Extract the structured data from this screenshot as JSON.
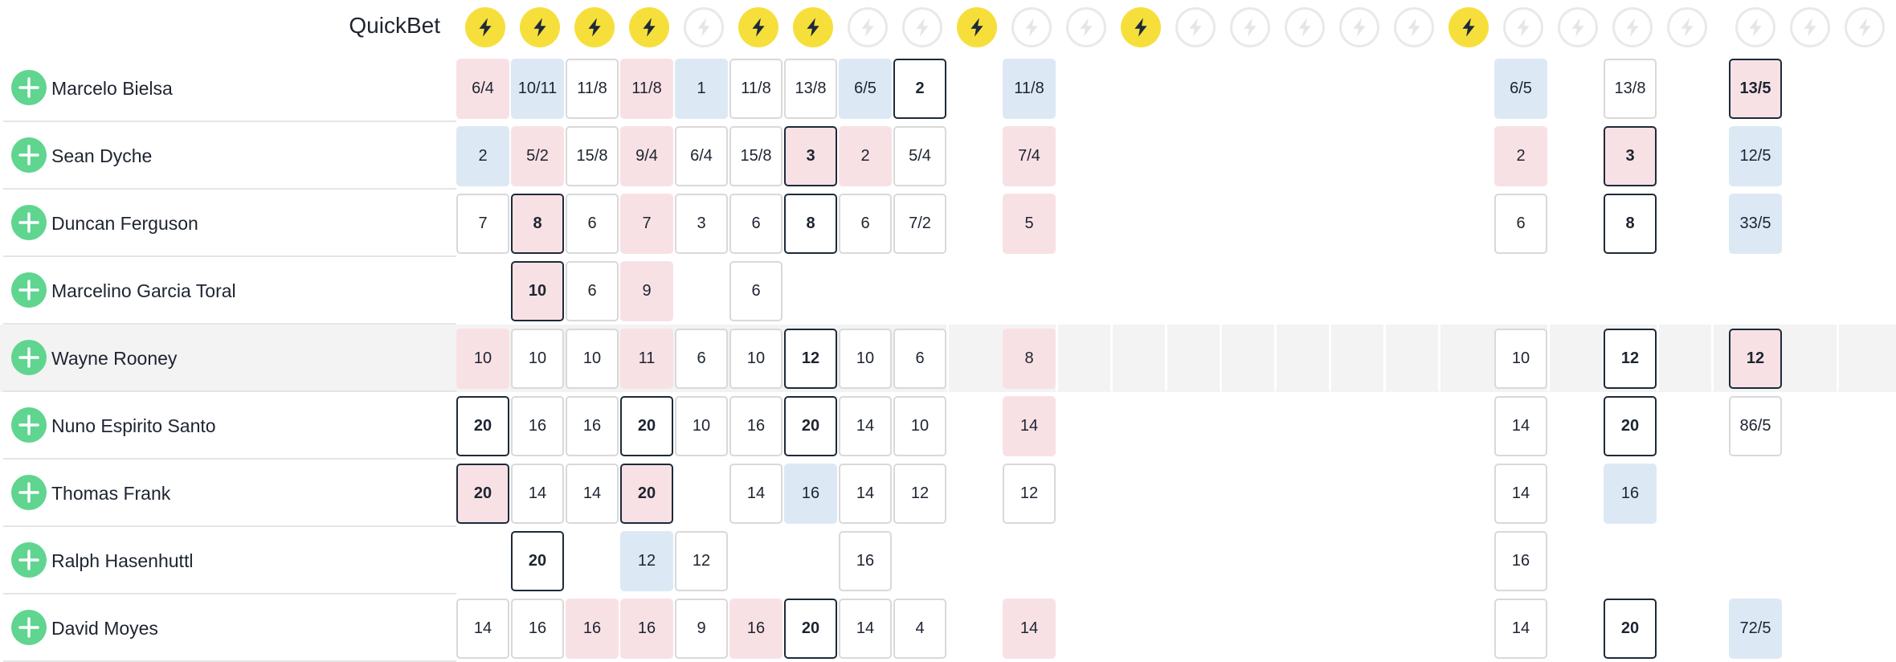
{
  "header": {
    "quickbet_label": "QuickBet",
    "bookmakers": [
      {
        "icon": "lightning-icon",
        "active": true
      },
      {
        "icon": "lightning-icon",
        "active": true
      },
      {
        "icon": "lightning-icon",
        "active": true
      },
      {
        "icon": "lightning-icon",
        "active": true
      },
      {
        "icon": "lightning-icon",
        "active": false
      },
      {
        "icon": "lightning-icon",
        "active": true
      },
      {
        "icon": "lightning-icon",
        "active": true
      },
      {
        "icon": "lightning-icon",
        "active": false
      },
      {
        "icon": "lightning-icon",
        "active": false
      },
      {
        "icon": "lightning-icon",
        "active": true
      },
      {
        "icon": "lightning-icon",
        "active": false
      },
      {
        "icon": "lightning-icon",
        "active": false
      },
      {
        "icon": "lightning-icon",
        "active": true
      },
      {
        "icon": "lightning-icon",
        "active": false
      },
      {
        "icon": "lightning-icon",
        "active": false
      },
      {
        "icon": "lightning-icon",
        "active": false
      },
      {
        "icon": "lightning-icon",
        "active": false
      },
      {
        "icon": "lightning-icon",
        "active": false
      },
      {
        "icon": "lightning-icon",
        "active": true
      },
      {
        "icon": "lightning-icon",
        "active": false
      },
      {
        "icon": "lightning-icon",
        "active": false
      },
      {
        "icon": "lightning-icon",
        "active": false
      },
      {
        "icon": "lightning-icon",
        "active": false
      },
      {
        "icon": "lightning-icon",
        "active": false
      },
      {
        "icon": "lightning-icon",
        "active": false
      },
      {
        "icon": "lightning-icon",
        "active": false
      }
    ]
  },
  "colors": {
    "quickbet_active": "#f7df3b",
    "add_button": "#5fd590",
    "odds_drifting": "#f8e1e5",
    "odds_shortening": "#dce9f5",
    "best_odds_border": "#1d2a39",
    "row_highlight": "#f3f3f3"
  },
  "rows": [
    {
      "name": "Marcelo Bielsa",
      "odds": [
        {
          "v": "6/4",
          "s": "p"
        },
        {
          "v": "10/11",
          "s": "b"
        },
        {
          "v": "11/8",
          "s": "w"
        },
        {
          "v": "11/8",
          "s": "p"
        },
        {
          "v": "1",
          "s": "b"
        },
        {
          "v": "11/8",
          "s": "w"
        },
        {
          "v": "13/8",
          "s": "w"
        },
        {
          "v": "6/5",
          "s": "b"
        },
        {
          "v": "2",
          "s": "w",
          "best": true
        },
        null,
        {
          "v": "11/8",
          "s": "b"
        },
        null,
        null,
        null,
        null,
        null,
        null,
        null,
        null,
        {
          "v": "6/5",
          "s": "b"
        },
        null,
        {
          "v": "13/8",
          "s": "w"
        },
        null,
        null,
        {
          "v": "13/5",
          "s": "p",
          "best": true
        },
        null
      ]
    },
    {
      "name": "Sean Dyche",
      "odds": [
        {
          "v": "2",
          "s": "b"
        },
        {
          "v": "5/2",
          "s": "p"
        },
        {
          "v": "15/8",
          "s": "w"
        },
        {
          "v": "9/4",
          "s": "p"
        },
        {
          "v": "6/4",
          "s": "w"
        },
        {
          "v": "15/8",
          "s": "w"
        },
        {
          "v": "3",
          "s": "p",
          "best": true
        },
        {
          "v": "2",
          "s": "p"
        },
        {
          "v": "5/4",
          "s": "w"
        },
        null,
        {
          "v": "7/4",
          "s": "p"
        },
        null,
        null,
        null,
        null,
        null,
        null,
        null,
        null,
        {
          "v": "2",
          "s": "p"
        },
        null,
        {
          "v": "3",
          "s": "p",
          "best": true
        },
        null,
        null,
        {
          "v": "12/5",
          "s": "b"
        },
        null
      ]
    },
    {
      "name": "Duncan Ferguson",
      "odds": [
        {
          "v": "7",
          "s": "w"
        },
        {
          "v": "8",
          "s": "p",
          "best": true
        },
        {
          "v": "6",
          "s": "w"
        },
        {
          "v": "7",
          "s": "p"
        },
        {
          "v": "3",
          "s": "w"
        },
        {
          "v": "6",
          "s": "w"
        },
        {
          "v": "8",
          "s": "w",
          "best": true
        },
        {
          "v": "6",
          "s": "w"
        },
        {
          "v": "7/2",
          "s": "w"
        },
        null,
        {
          "v": "5",
          "s": "p"
        },
        null,
        null,
        null,
        null,
        null,
        null,
        null,
        null,
        {
          "v": "6",
          "s": "w"
        },
        null,
        {
          "v": "8",
          "s": "w",
          "best": true
        },
        null,
        null,
        {
          "v": "33/5",
          "s": "b"
        },
        null
      ]
    },
    {
      "name": "Marcelino Garcia Toral",
      "odds": [
        null,
        {
          "v": "10",
          "s": "p",
          "best": true
        },
        {
          "v": "6",
          "s": "w"
        },
        {
          "v": "9",
          "s": "p"
        },
        null,
        {
          "v": "6",
          "s": "w"
        },
        null,
        null,
        null,
        null,
        null,
        null,
        null,
        null,
        null,
        null,
        null,
        null,
        null,
        null,
        null,
        null,
        null,
        null,
        null,
        null
      ]
    },
    {
      "name": "Wayne Rooney",
      "highlight": true,
      "odds": [
        {
          "v": "10",
          "s": "p"
        },
        {
          "v": "10",
          "s": "w"
        },
        {
          "v": "10",
          "s": "w"
        },
        {
          "v": "11",
          "s": "p"
        },
        {
          "v": "6",
          "s": "w"
        },
        {
          "v": "10",
          "s": "w"
        },
        {
          "v": "12",
          "s": "w",
          "best": true
        },
        {
          "v": "10",
          "s": "w"
        },
        {
          "v": "6",
          "s": "w"
        },
        null,
        {
          "v": "8",
          "s": "p"
        },
        null,
        null,
        null,
        null,
        null,
        null,
        null,
        null,
        {
          "v": "10",
          "s": "w"
        },
        null,
        {
          "v": "12",
          "s": "w",
          "best": true
        },
        null,
        null,
        {
          "v": "12",
          "s": "p",
          "best": true
        },
        null
      ]
    },
    {
      "name": "Nuno Espirito Santo",
      "odds": [
        {
          "v": "20",
          "s": "w",
          "best": true
        },
        {
          "v": "16",
          "s": "w"
        },
        {
          "v": "16",
          "s": "w"
        },
        {
          "v": "20",
          "s": "w",
          "best": true
        },
        {
          "v": "10",
          "s": "w"
        },
        {
          "v": "16",
          "s": "w"
        },
        {
          "v": "20",
          "s": "w",
          "best": true
        },
        {
          "v": "14",
          "s": "w"
        },
        {
          "v": "10",
          "s": "w"
        },
        null,
        {
          "v": "14",
          "s": "p"
        },
        null,
        null,
        null,
        null,
        null,
        null,
        null,
        null,
        {
          "v": "14",
          "s": "w"
        },
        null,
        {
          "v": "20",
          "s": "w",
          "best": true
        },
        null,
        null,
        {
          "v": "86/5",
          "s": "w"
        },
        null
      ]
    },
    {
      "name": "Thomas Frank",
      "odds": [
        {
          "v": "20",
          "s": "p",
          "best": true
        },
        {
          "v": "14",
          "s": "w"
        },
        {
          "v": "14",
          "s": "w"
        },
        {
          "v": "20",
          "s": "p",
          "best": true
        },
        null,
        {
          "v": "14",
          "s": "w"
        },
        {
          "v": "16",
          "s": "b"
        },
        {
          "v": "14",
          "s": "w"
        },
        {
          "v": "12",
          "s": "w"
        },
        null,
        {
          "v": "12",
          "s": "w"
        },
        null,
        null,
        null,
        null,
        null,
        null,
        null,
        null,
        {
          "v": "14",
          "s": "w"
        },
        null,
        {
          "v": "16",
          "s": "b"
        },
        null,
        null,
        null,
        null
      ]
    },
    {
      "name": "Ralph Hasenhuttl",
      "odds": [
        null,
        {
          "v": "20",
          "s": "w",
          "best": true
        },
        null,
        {
          "v": "12",
          "s": "b"
        },
        {
          "v": "12",
          "s": "w"
        },
        null,
        null,
        {
          "v": "16",
          "s": "w"
        },
        null,
        null,
        null,
        null,
        null,
        null,
        null,
        null,
        null,
        null,
        null,
        {
          "v": "16",
          "s": "w"
        },
        null,
        null,
        null,
        null,
        null,
        null
      ]
    },
    {
      "name": "David Moyes",
      "odds": [
        {
          "v": "14",
          "s": "w"
        },
        {
          "v": "16",
          "s": "w"
        },
        {
          "v": "16",
          "s": "p"
        },
        {
          "v": "16",
          "s": "p"
        },
        {
          "v": "9",
          "s": "w"
        },
        {
          "v": "16",
          "s": "p"
        },
        {
          "v": "20",
          "s": "w",
          "best": true
        },
        {
          "v": "14",
          "s": "w"
        },
        {
          "v": "4",
          "s": "w"
        },
        null,
        {
          "v": "14",
          "s": "p"
        },
        null,
        null,
        null,
        null,
        null,
        null,
        null,
        null,
        {
          "v": "14",
          "s": "w"
        },
        null,
        {
          "v": "20",
          "s": "w",
          "best": true
        },
        null,
        null,
        {
          "v": "72/5",
          "s": "b"
        },
        null
      ]
    }
  ]
}
